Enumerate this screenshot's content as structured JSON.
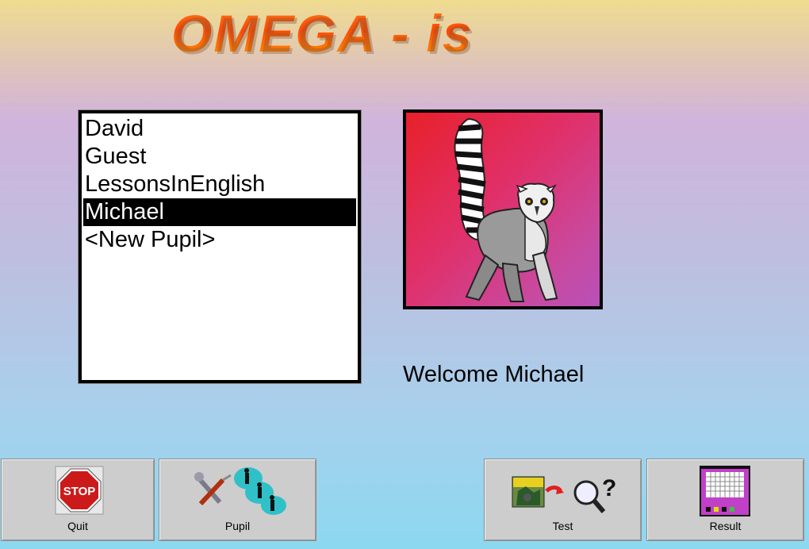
{
  "app": {
    "title": "OMEGA - is"
  },
  "pupils": {
    "items": [
      "David",
      "Guest",
      "LessonsInEnglish",
      "Michael",
      "<New Pupil>"
    ],
    "selected_index": 3
  },
  "welcome": {
    "text": "Welcome Michael"
  },
  "toolbar": {
    "quit_label": "Quit",
    "pupil_label": "Pupil",
    "test_label": "Test",
    "result_label": "Result"
  },
  "icons": {
    "quit": "stop-sign-icon",
    "pupil": "tools-and-people-icon",
    "test": "picture-to-magnifier-icon",
    "result": "results-grid-icon"
  },
  "colors": {
    "title_orange": "#ff5a00",
    "avatar_bg": "#e0306a",
    "selection": "#000000"
  }
}
